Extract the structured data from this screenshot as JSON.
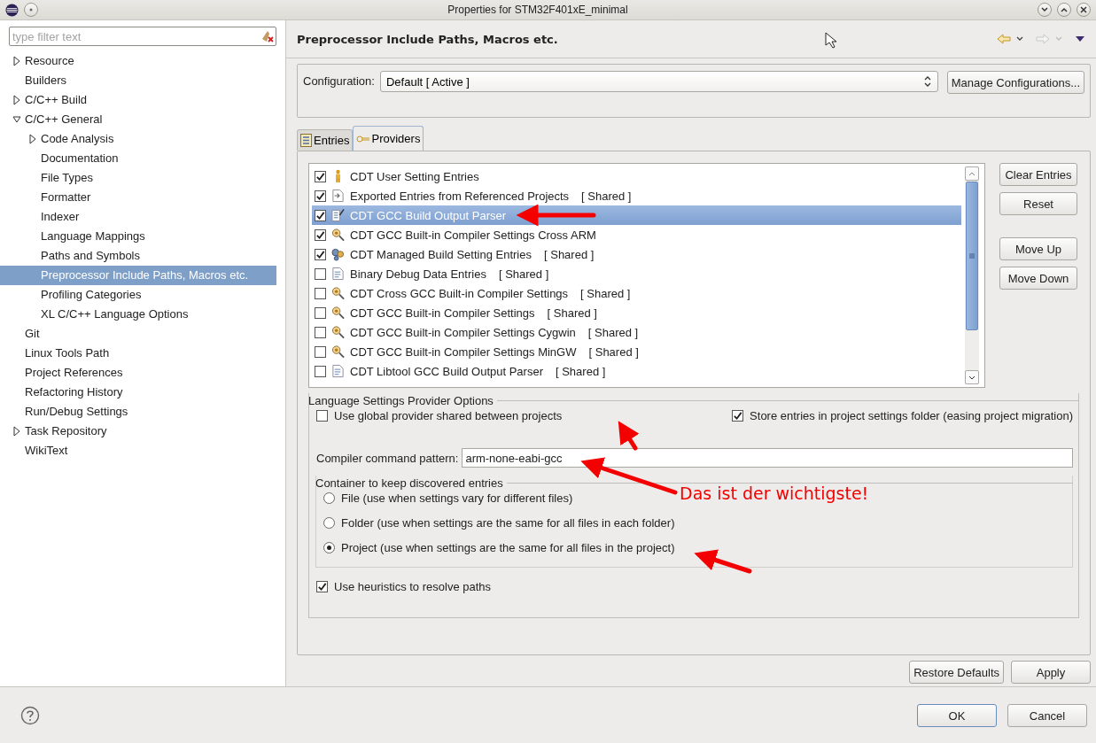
{
  "window": {
    "title": "Properties for STM32F401xE_minimal"
  },
  "filter": {
    "placeholder": "type filter text"
  },
  "tree": [
    {
      "label": "Resource",
      "expanded": false,
      "selected": false
    },
    {
      "label": "Builders",
      "selected": false
    },
    {
      "label": "C/C++ Build",
      "expanded": false,
      "selected": false
    },
    {
      "label": "C/C++ General",
      "expanded": true,
      "selected": false,
      "children": [
        {
          "label": "Code Analysis",
          "expanded": false,
          "selected": false
        },
        {
          "label": "Documentation",
          "selected": false
        },
        {
          "label": "File Types",
          "selected": false
        },
        {
          "label": "Formatter",
          "selected": false
        },
        {
          "label": "Indexer",
          "selected": false
        },
        {
          "label": "Language Mappings",
          "selected": false
        },
        {
          "label": "Paths and Symbols",
          "selected": false
        },
        {
          "label": "Preprocessor Include Paths, Macros etc.",
          "selected": true
        },
        {
          "label": "Profiling Categories",
          "selected": false
        },
        {
          "label": "XL C/C++ Language Options",
          "selected": false
        }
      ]
    },
    {
      "label": "Git",
      "selected": false
    },
    {
      "label": "Linux Tools Path",
      "selected": false
    },
    {
      "label": "Project References",
      "selected": false
    },
    {
      "label": "Refactoring History",
      "selected": false
    },
    {
      "label": "Run/Debug Settings",
      "selected": false
    },
    {
      "label": "Task Repository",
      "expanded": false,
      "selected": false
    },
    {
      "label": "WikiText",
      "selected": false
    }
  ],
  "page": {
    "title": "Preprocessor Include Paths, Macros etc.",
    "back_enabled": true,
    "forward_enabled": false
  },
  "configuration": {
    "label": "Configuration:",
    "value": "Default  [ Active ]",
    "button": "Manage Configurations..."
  },
  "tabs": [
    {
      "label": "Entries",
      "kind": "entries",
      "selected": false
    },
    {
      "label": "Providers",
      "kind": "providers",
      "selected": true
    }
  ],
  "providers": [
    {
      "name": "CDT User Setting Entries",
      "kind": "person",
      "checked": true,
      "selected": false
    },
    {
      "name": "Exported Entries from Referenced Projects",
      "tag": "[ Shared ]",
      "kind": "export",
      "checked": true,
      "selected": false
    },
    {
      "name": "CDT GCC Build Output Parser",
      "kind": "parser",
      "checked": true,
      "selected": true
    },
    {
      "name": "CDT GCC Built-in Compiler Settings Cross ARM",
      "kind": "compiler",
      "checked": true,
      "selected": false
    },
    {
      "name": "CDT Managed Build Setting Entries",
      "tag": "[ Shared ]",
      "kind": "managed",
      "checked": true,
      "selected": false
    },
    {
      "name": "Binary Debug Data Entries",
      "tag": "[ Shared ]",
      "kind": "document",
      "checked": false,
      "selected": false
    },
    {
      "name": "CDT Cross GCC Built-in Compiler Settings",
      "tag": "[ Shared ]",
      "kind": "compiler",
      "checked": false,
      "selected": false
    },
    {
      "name": "CDT GCC Built-in Compiler Settings",
      "tag": "[ Shared ]",
      "kind": "compiler",
      "checked": false,
      "selected": false
    },
    {
      "name": "CDT GCC Built-in Compiler Settings Cygwin",
      "tag": "[ Shared ]",
      "kind": "compiler",
      "checked": false,
      "selected": false
    },
    {
      "name": "CDT GCC Built-in Compiler Settings MinGW",
      "tag": "[ Shared ]",
      "kind": "compiler",
      "checked": false,
      "selected": false
    },
    {
      "name": "CDT Libtool GCC Build Output Parser",
      "tag": "[ Shared ]",
      "kind": "document",
      "checked": false,
      "selected": false
    }
  ],
  "provider_buttons": [
    "Clear Entries",
    "Reset",
    "Move Up",
    "Move Down"
  ],
  "options": {
    "legend": "Language Settings Provider Options",
    "global": {
      "label": "Use global provider shared between projects",
      "checked": false
    },
    "store": {
      "label": "Store entries in project settings folder (easing project migration)",
      "checked": true
    },
    "pattern_label": "Compiler command pattern:",
    "pattern_value": "arm-none-eabi-gcc",
    "container": {
      "legend": "Container to keep discovered entries",
      "choices": [
        {
          "label": "File (use when settings vary for different files)",
          "selected": false
        },
        {
          "label": "Folder (use when settings are the same for all files in each folder)",
          "selected": false
        },
        {
          "label": "Project (use when settings are the same for all files in the project)",
          "selected": true
        }
      ]
    },
    "heuristics": {
      "label": "Use heuristics to resolve paths",
      "checked": true
    }
  },
  "page_buttons": [
    "Restore Defaults",
    "Apply"
  ],
  "dialog_buttons": [
    {
      "label": "OK",
      "default": true
    },
    {
      "label": "Cancel",
      "default": false
    }
  ],
  "annotation": {
    "text": "Das ist der wichtigste!"
  }
}
